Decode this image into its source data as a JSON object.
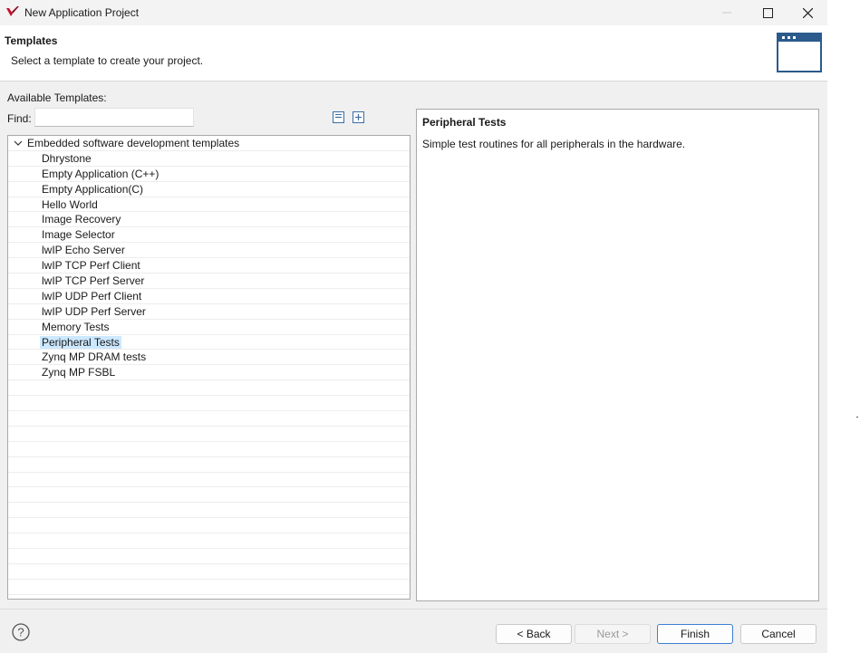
{
  "window": {
    "title": "New Application Project",
    "accent": "#c8102e"
  },
  "header": {
    "title": "Templates",
    "description": "Select a template to create your project."
  },
  "left": {
    "available_label": "Available Templates:",
    "find_label": "Find:",
    "find_value": "",
    "tree": {
      "root_label": "Embedded software development templates",
      "items": [
        {
          "label": "Dhrystone"
        },
        {
          "label": "Empty Application (C++)"
        },
        {
          "label": "Empty Application(C)"
        },
        {
          "label": "Hello World"
        },
        {
          "label": "Image Recovery"
        },
        {
          "label": "Image Selector"
        },
        {
          "label": "lwIP Echo Server"
        },
        {
          "label": "lwIP TCP Perf Client"
        },
        {
          "label": "lwIP TCP Perf Server"
        },
        {
          "label": "lwIP UDP Perf Client"
        },
        {
          "label": "lwIP UDP Perf Server"
        },
        {
          "label": "Memory Tests"
        },
        {
          "label": "Peripheral Tests",
          "selected": true
        },
        {
          "label": "Zynq MP DRAM tests"
        },
        {
          "label": "Zynq MP FSBL"
        }
      ]
    }
  },
  "detail": {
    "title": "Peripheral Tests",
    "description": "Simple test routines for all peripherals in the hardware."
  },
  "footer": {
    "back_label": "< Back",
    "next_label": "Next >",
    "finish_label": "Finish",
    "cancel_label": "Cancel"
  }
}
